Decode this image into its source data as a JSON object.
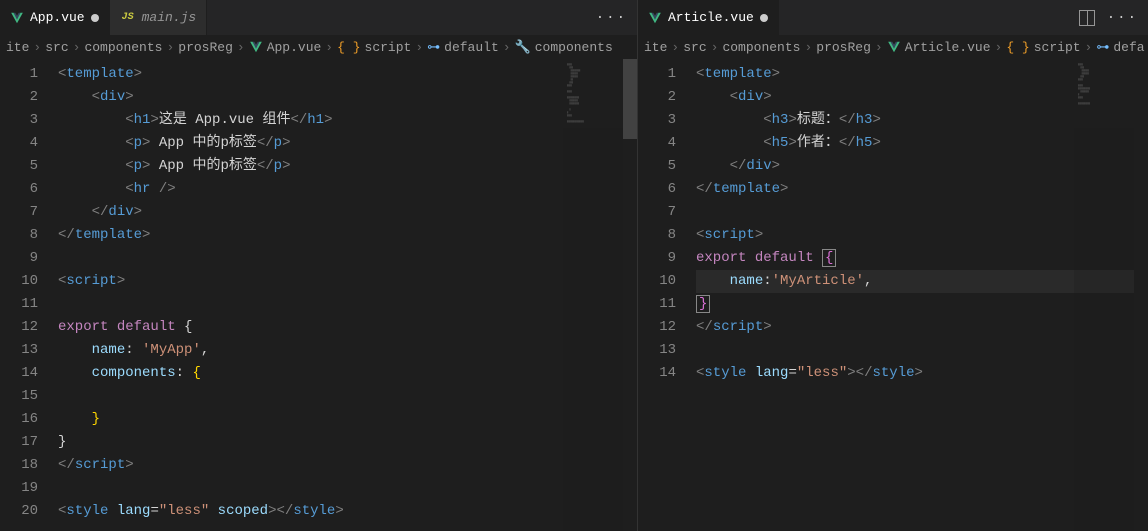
{
  "left": {
    "tabs": [
      {
        "label": "App.vue",
        "active": true,
        "dirty": true,
        "icon": "vue"
      },
      {
        "label": "main.js",
        "active": false,
        "dirty": false,
        "icon": "js",
        "italic": true
      }
    ],
    "breadcrumbs": [
      {
        "label": "ite"
      },
      {
        "label": "src"
      },
      {
        "label": "components"
      },
      {
        "label": "prosReg"
      },
      {
        "label": "App.vue",
        "icon": "vue"
      },
      {
        "label": "script",
        "icon": "braces"
      },
      {
        "label": "default",
        "icon": "link"
      },
      {
        "label": "components",
        "icon": "wrench"
      }
    ],
    "lines": [
      "1",
      "2",
      "3",
      "4",
      "5",
      "6",
      "7",
      "8",
      "9",
      "10",
      "11",
      "12",
      "13",
      "14",
      "15",
      "16",
      "17",
      "18",
      "19",
      "20"
    ],
    "code": {
      "l1_text": "这是 App.vue 组件",
      "l2_text": " App 中的p标签",
      "l3_text": " App 中的p标签",
      "name_val": "'MyApp'",
      "lang_val": "\"less\""
    }
  },
  "right": {
    "tabs": [
      {
        "label": "Article.vue",
        "active": true,
        "dirty": true,
        "icon": "vue"
      }
    ],
    "breadcrumbs": [
      {
        "label": "ite"
      },
      {
        "label": "src"
      },
      {
        "label": "components"
      },
      {
        "label": "prosReg"
      },
      {
        "label": "Article.vue",
        "icon": "vue"
      },
      {
        "label": "script",
        "icon": "braces"
      },
      {
        "label": "defa",
        "icon": "link"
      }
    ],
    "lines": [
      "1",
      "2",
      "3",
      "4",
      "5",
      "6",
      "7",
      "8",
      "9",
      "10",
      "11",
      "12",
      "13",
      "14"
    ],
    "code": {
      "h3_text": "标题：",
      "h5_text": "作者：",
      "name_val": "'MyArticle'",
      "lang_val": "\"less\""
    }
  },
  "tab_actions": {
    "more": "···"
  }
}
